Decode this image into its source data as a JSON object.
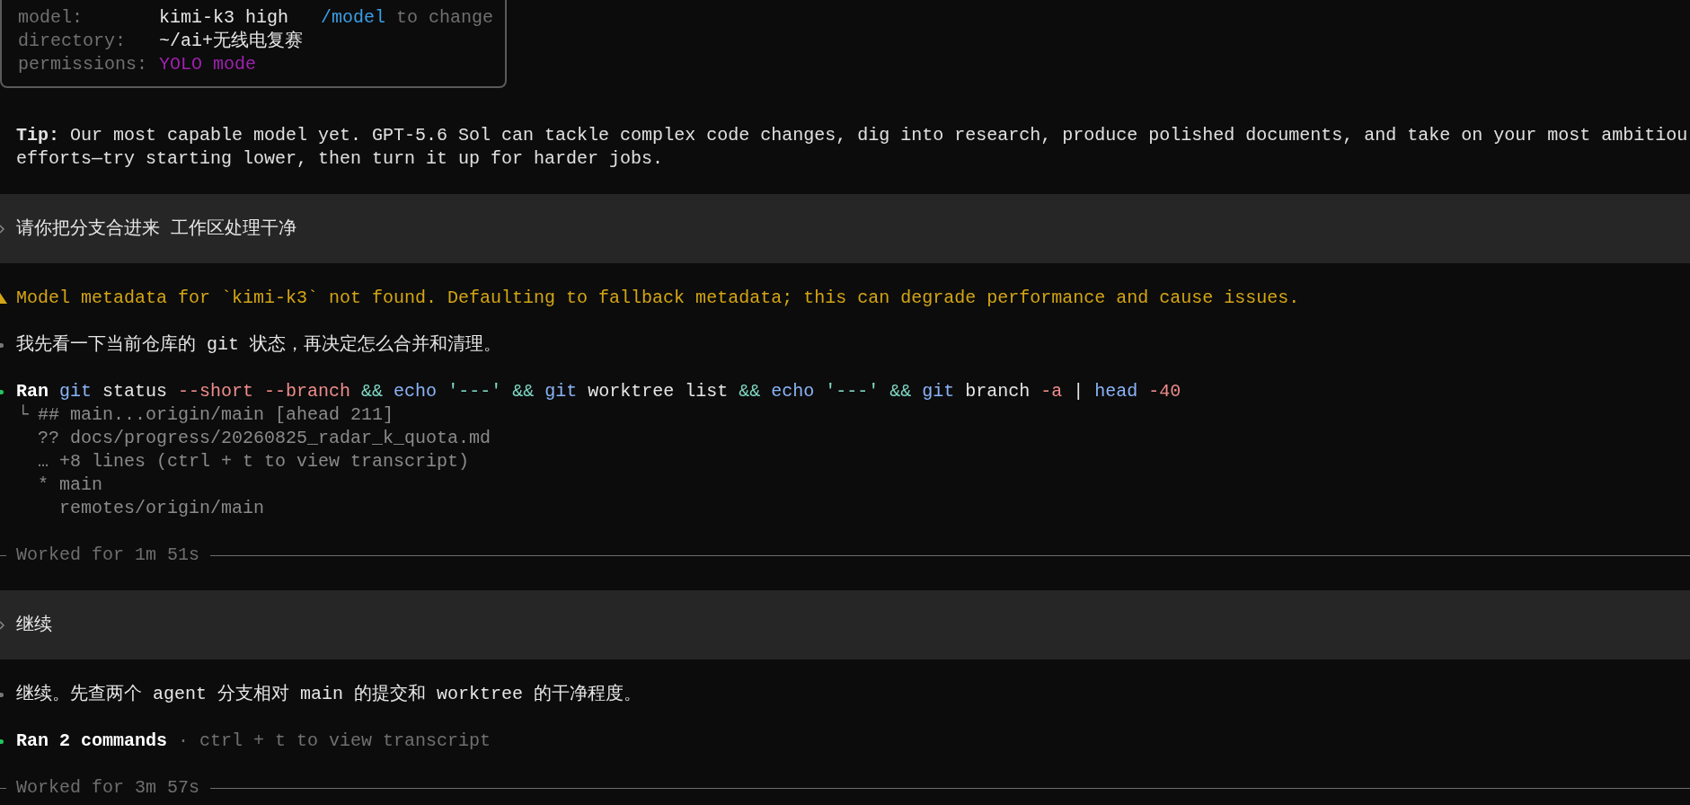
{
  "session_info": {
    "rows": [
      {
        "label": "model:",
        "value": "kimi-k3 high",
        "hint_command": "/model",
        "hint": "to change",
        "kind": "plain"
      },
      {
        "label": "directory:",
        "value": "~/ai+无线电复赛",
        "kind": "plain"
      },
      {
        "label": "permissions:",
        "value": "YOLO mode",
        "kind": "highlight"
      }
    ]
  },
  "tip": {
    "lines": [
      "**Tip:** Our most capable model yet. GPT-5.6 Sol can tackle complex code changes, dig into research, produce polished documents, and take on your most ambitiou",
      "efforts—try starting lower, then turn it up for harder jobs."
    ]
  },
  "transcript": [
    {
      "kind": "user_message",
      "text": "请你把分支合进来 工作区处理干净"
    },
    {
      "kind": "warning",
      "text": "Model metadata for `kimi-k3` not found. Defaulting to fallback metadata; this can degrade performance and cause issues."
    },
    {
      "kind": "assistant_message",
      "text": "我先看一下当前仓库的 git 状态，再决定怎么合并和清理。"
    },
    {
      "kind": "command",
      "verb": "Ran",
      "tokens": [
        {
          "text": "git",
          "kind": "program"
        },
        {
          "text": "status",
          "kind": "arg"
        },
        {
          "text": "--short",
          "kind": "flag"
        },
        {
          "text": "--branch",
          "kind": "flag"
        },
        {
          "text": "&&",
          "kind": "operator"
        },
        {
          "text": "echo",
          "kind": "program"
        },
        {
          "text": "'---'",
          "kind": "string"
        },
        {
          "text": "&&",
          "kind": "operator"
        },
        {
          "text": "git",
          "kind": "program"
        },
        {
          "text": "worktree",
          "kind": "arg"
        },
        {
          "text": "list",
          "kind": "arg"
        },
        {
          "text": "&&",
          "kind": "operator"
        },
        {
          "text": "echo",
          "kind": "program"
        },
        {
          "text": "'---'",
          "kind": "string"
        },
        {
          "text": "&&",
          "kind": "operator"
        },
        {
          "text": "git",
          "kind": "program"
        },
        {
          "text": "branch",
          "kind": "arg"
        },
        {
          "text": "-a",
          "kind": "flag"
        },
        {
          "text": "|",
          "kind": "pipe"
        },
        {
          "text": "head",
          "kind": "program"
        },
        {
          "text": "-40",
          "kind": "flag"
        }
      ],
      "tree_marker": "└",
      "output": [
        "## main...origin/main [ahead 211]",
        "?? docs/progress/20260825_radar_k_quota.md",
        "… +8 lines (ctrl + t to view transcript)",
        "* main",
        "  remotes/origin/main"
      ]
    },
    {
      "kind": "worked_for",
      "text": "Worked for 1m 51s"
    },
    {
      "kind": "user_message",
      "text": "继续"
    },
    {
      "kind": "assistant_message",
      "text": "继续。先查两个 agent 分支相对 main 的提交和 worktree 的干净程度。"
    },
    {
      "kind": "command_summary",
      "verb": "Ran 2 commands",
      "hint": "· ctrl + t to view transcript"
    },
    {
      "kind": "worked_for",
      "text": "Worked for 3m 57s"
    }
  ]
}
